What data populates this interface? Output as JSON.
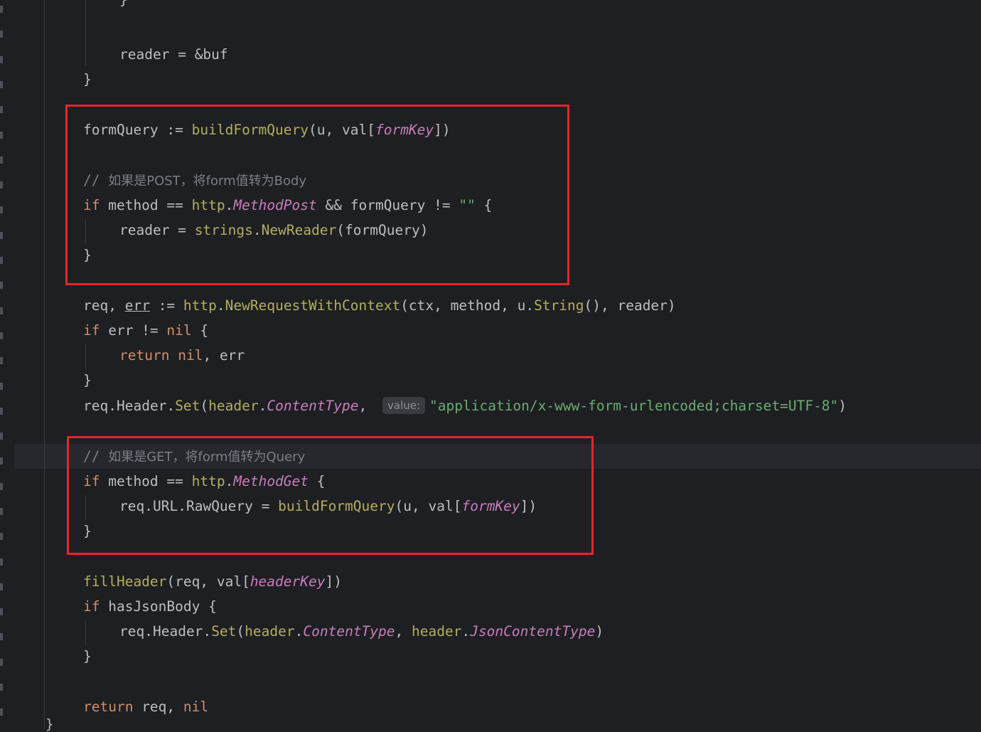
{
  "colors": {
    "background": "#1e1f22",
    "keyword": "#cf8e6d",
    "constant": "#c77dbb",
    "string": "#6aab73",
    "comment": "#7a7e85",
    "highlight_box": "#e3262c"
  },
  "code": {
    "top_brace": "}",
    "reader_var": "reader",
    "assign_op": " = ",
    "buf_ref": "&buf",
    "close_brace": "}",
    "formQuery": "formQuery",
    "decl_op": " := ",
    "buildFormQuery": "buildFormQuery",
    "open_paren": "(",
    "u": "u",
    "comma": ", ",
    "val": "val",
    "lbracket": "[",
    "formKey": "formKey",
    "rbracket_paren": "])",
    "comment_post_slash": "// ",
    "comment_post_text": "如果是POST，将form值转为Body",
    "kw_if": "if",
    "method": " method ",
    "eq_op": "== ",
    "http": "http",
    "dot": ".",
    "MethodPost": "MethodPost",
    "and_op": " && ",
    "neq_empty": " != ",
    "empty_str": "\"\"",
    "open_brace": " {",
    "strings": "strings",
    "NewReader": "NewReader",
    "paren_formQuery": "(formQuery)",
    "req": "req",
    "err": "err",
    "NewRequestWithContext": "NewRequestWithContext",
    "args_ctx_method": "(ctx, method, ",
    "String_call": "String",
    "args_tail": "(), reader)",
    "if_err_rest": " err != ",
    "nil": "nil",
    "kw_return": "return",
    "return_tail_err": ", err",
    "Header": "Header",
    "Set": "Set",
    "header": "header",
    "ContentType": "ContentType",
    "hint_value": "value:",
    "content_type_value": "\"application/x-www-form-urlencoded;charset=UTF-8\"",
    "close_paren": ")",
    "comment_get_text": "如果是GET，将form值转为Query",
    "MethodGet": "MethodGet",
    "URL": "URL",
    "RawQuery": "RawQuery",
    "fillHeader": "fillHeader",
    "paren_req_val": "(req, val[",
    "headerKey": "headerKey",
    "hasJsonBody": " hasJsonBody",
    "JsonContentType": "JsonContentType",
    "return_req": " req, ",
    "final_brace": "}"
  }
}
